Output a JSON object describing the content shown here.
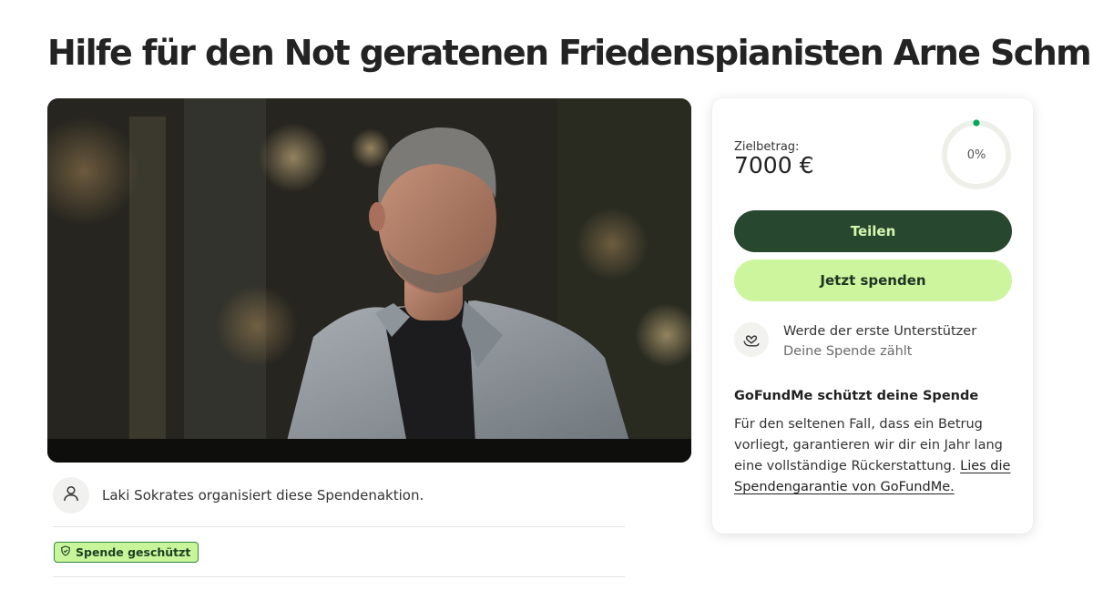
{
  "campaign": {
    "title": "Hilfe für den Not geratenen Friedenspianisten Arne Schmitt",
    "hero_image": "portrait-photo"
  },
  "organizer": {
    "text": "Laki Sokrates organisiert diese Spendenaktion.",
    "avatar_icon": "person-icon"
  },
  "badge": {
    "icon": "shield-icon",
    "label": "Spende geschützt",
    "background": "#c8f59a"
  },
  "donation_card": {
    "goal_label": "Zielbetrag:",
    "goal_value": "7000 €",
    "progress": 0,
    "progress_text": "0%",
    "share_button": "Teilen",
    "donate_button": "Jetzt spenden",
    "supporter_icon": "heart-hand-icon",
    "supporter_main": "Werde der erste Unterstützer",
    "supporter_sub": "Deine Spende zählt",
    "protect_title": "GoFundMe schützt deine Spende",
    "protect_body": "Für den seltenen Fall, dass ein Betrug vorliegt, garantieren wir dir ein Jahr lang eine vollständige Rückerstattung.",
    "protect_link": "Lies die Spendengarantie von GoFundMe."
  },
  "colors": {
    "share_button_bg": "#27472f",
    "donate_button_bg": "#cdf59e",
    "progress_accent": "#02a95c"
  }
}
